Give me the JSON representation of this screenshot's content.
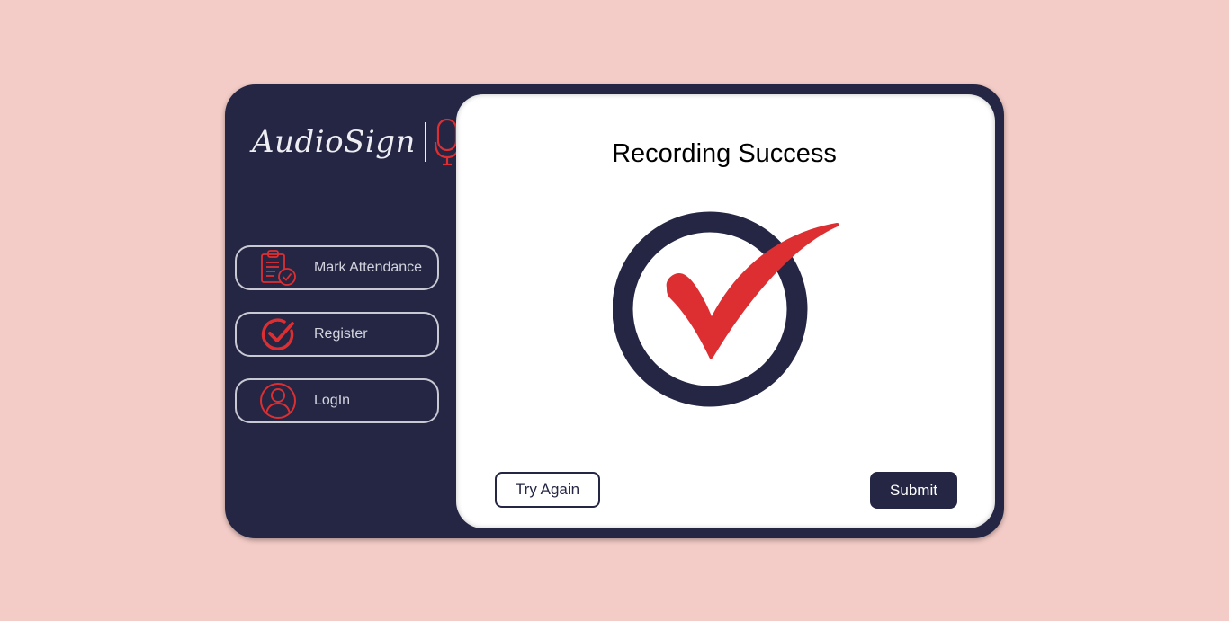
{
  "brand": {
    "name": "AudioSign",
    "icon": "microphone-icon"
  },
  "sidebar": {
    "items": [
      {
        "label": "Mark Attendance",
        "icon": "clipboard-check-icon"
      },
      {
        "label": "Register",
        "icon": "circle-check-icon"
      },
      {
        "label": "LogIn",
        "icon": "user-circle-icon"
      }
    ]
  },
  "main": {
    "title": "Recording Success",
    "status_icon": "success-checkmark-icon",
    "try_again_label": "Try Again",
    "submit_label": "Submit"
  },
  "colors": {
    "background": "#f4ccc7",
    "navy": "#242644",
    "accent_red": "#dd2f32",
    "panel": "#ffffff"
  }
}
